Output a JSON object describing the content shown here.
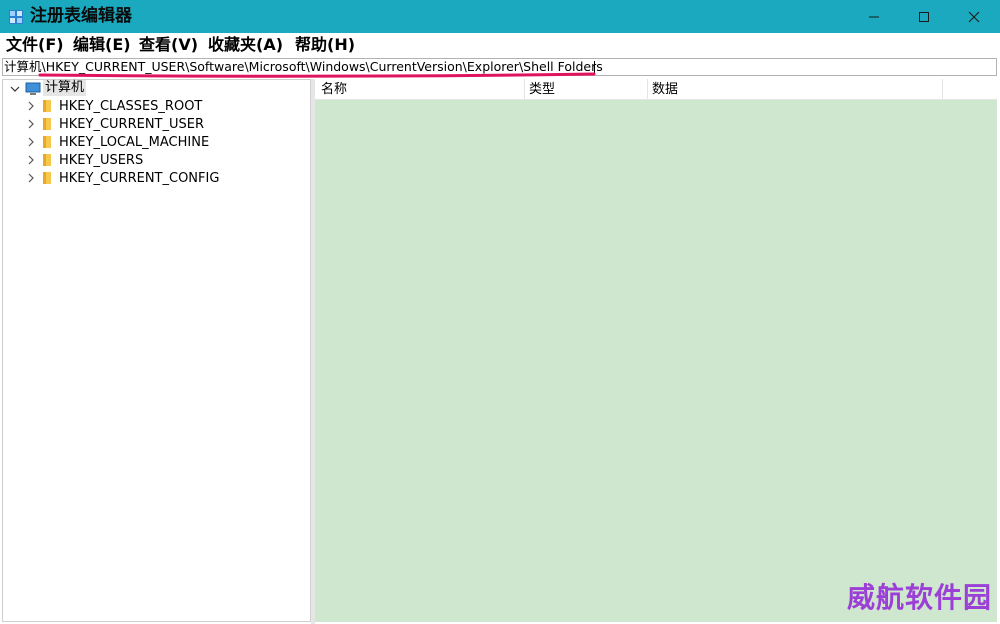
{
  "window": {
    "title": "注册表编辑器",
    "controls": [
      "minimize-icon",
      "maximize-icon",
      "close-icon"
    ],
    "titlebar_color": "#1aa9bf"
  },
  "menu": [
    {
      "label": "文件(F)"
    },
    {
      "label": "编辑(E)"
    },
    {
      "label": "查看(V)"
    },
    {
      "label": "收藏夹(A)"
    },
    {
      "label": "帮助(H)"
    }
  ],
  "address": {
    "path": "计算机\\HKEY_CURRENT_USER\\Software\\Microsoft\\Windows\\CurrentVersion\\Explorer\\Shell Folders",
    "highlight_color": "#e0135f"
  },
  "tree": {
    "root": "计算机",
    "items": [
      {
        "label": "HKEY_CLASSES_ROOT"
      },
      {
        "label": "HKEY_CURRENT_USER"
      },
      {
        "label": "HKEY_LOCAL_MACHINE"
      },
      {
        "label": "HKEY_USERS"
      },
      {
        "label": "HKEY_CURRENT_CONFIG"
      }
    ]
  },
  "list": {
    "columns": [
      "名称",
      "类型",
      "数据"
    ],
    "background": "#cfe6cf"
  },
  "watermark": "威航软件园"
}
